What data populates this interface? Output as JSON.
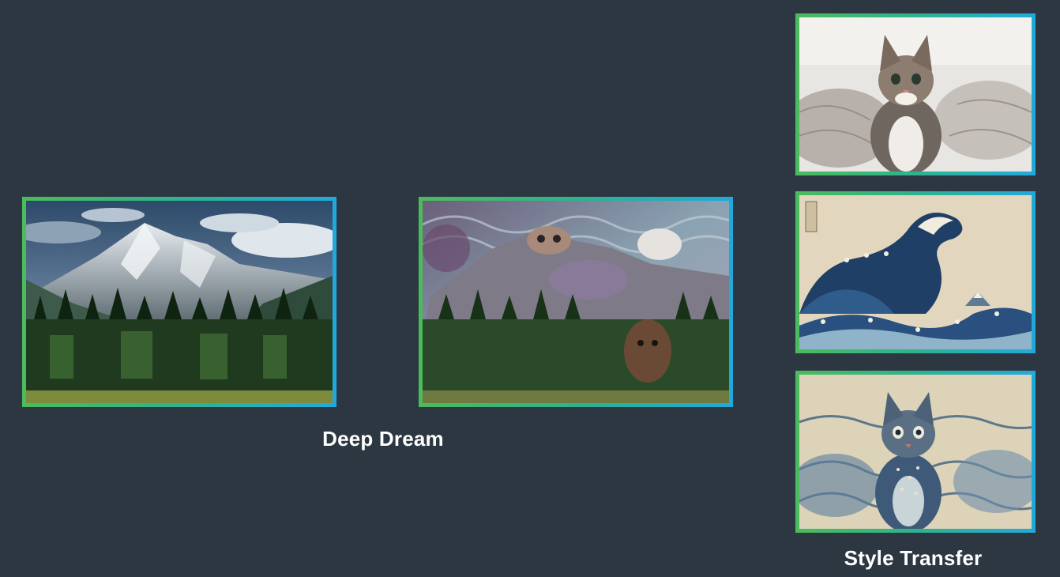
{
  "captions": {
    "deep_dream": "Deep Dream",
    "style_transfer": "Style Transfer"
  },
  "images": [
    {
      "name": "mountain-forest-original-image",
      "subject": "mountain-forest-photo"
    },
    {
      "name": "deep-dream-mountain-image",
      "subject": "deep-dream-mountain"
    },
    {
      "name": "kitten-content-image",
      "subject": "kitten-photo"
    },
    {
      "name": "great-wave-style-image",
      "subject": "great-wave-painting"
    },
    {
      "name": "stylized-kitten-output-image",
      "subject": "stylized-kitten"
    }
  ],
  "colors": {
    "background": "#2c3742",
    "frame_green": "#4cbb5c",
    "frame_blue": "#22a9dc",
    "caption_text": "#ffffff"
  }
}
